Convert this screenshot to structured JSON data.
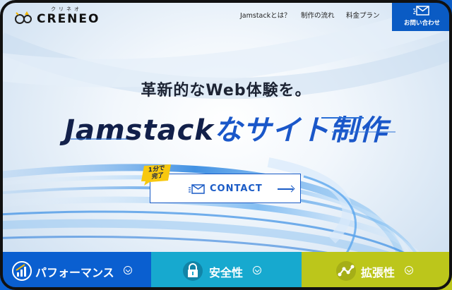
{
  "brand": {
    "ruby": "クリネオ",
    "name": "CRENEO"
  },
  "nav": {
    "items": [
      {
        "label": "Jamstackとは？"
      },
      {
        "label": "制作の流れ"
      },
      {
        "label": "料金プラン"
      }
    ],
    "contact_label": "お問い合わせ"
  },
  "hero": {
    "tagline": "革新的なWeb体験を。",
    "headline_part1": "Jamstack",
    "headline_part2": "なサイト制作",
    "badge_line1": "1分で",
    "badge_line2": "完了",
    "cta_label": "CONTACT"
  },
  "features": [
    {
      "label": "パフォーマンス",
      "icon": "performance-chart-icon",
      "color": "#0a5fd0"
    },
    {
      "label": "安全性",
      "icon": "lock-icon",
      "color": "#17a9cf"
    },
    {
      "label": "拡張性",
      "icon": "network-nodes-icon",
      "color": "#bcc61b"
    }
  ],
  "colors": {
    "accent_blue": "#0a5bc4",
    "headline_navy": "#12204a",
    "headline_blue": "#1a57c9"
  }
}
